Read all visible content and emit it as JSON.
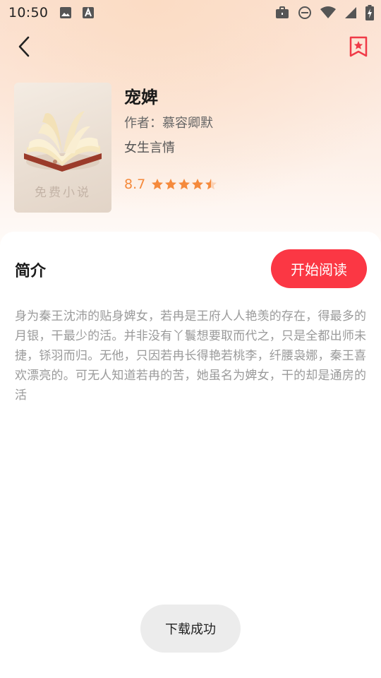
{
  "status_bar": {
    "time": "10:50",
    "left_icons": [
      "image-icon",
      "font-icon"
    ],
    "right_icons": [
      "briefcase-icon",
      "do-not-disturb-icon",
      "wifi-icon",
      "signal-icon",
      "battery-charging-icon"
    ]
  },
  "nav": {
    "back_icon": "chevron-left-icon",
    "bookmark_icon": "bookmark-star-icon",
    "accent_color": "#f03a47"
  },
  "book": {
    "cover_text": "免费小说",
    "title": "宠婢",
    "author": "作者：慕容卿默",
    "category": "女生言情",
    "rating": "8.7",
    "stars_filled": 4.5,
    "stars_total": 5,
    "rating_color": "#f58a3c"
  },
  "intro": {
    "heading": "简介",
    "start_button": "开始阅读",
    "button_color": "#fb3744",
    "synopsis": "身为秦王沈沛的贴身婢女，若冉是王府人人艳羡的存在，得最多的月银，干最少的活。并非没有丫鬟想要取而代之，只是全都出师未捷，铩羽而归。无他，只因若冉长得艳若桃李，纤腰袅娜，秦王喜欢漂亮的。可无人知道若冉的苦，她虽名为婢女，干的却是通房的活"
  },
  "toast": {
    "message": "下载成功"
  }
}
